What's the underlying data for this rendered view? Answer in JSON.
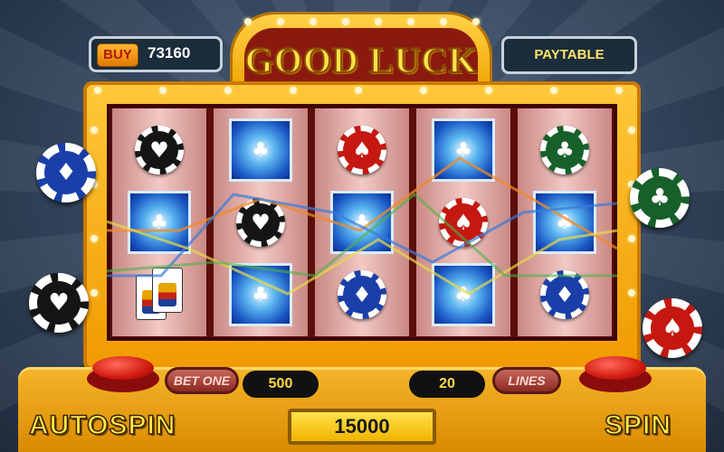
{
  "header": {
    "buy_label": "BUY",
    "credits": "73160",
    "title": "GOOD LUCK",
    "paytable_label": "PAYTABLE"
  },
  "reels": [
    [
      "chip-black-heart",
      "wild",
      "cards-king-queen"
    ],
    [
      "wild",
      "chip-black-heart",
      "wild"
    ],
    [
      "chip-red-spade",
      "wild",
      "chip-blue-diamond"
    ],
    [
      "wild",
      "chip-red-spade",
      "wild"
    ],
    [
      "chip-green-club",
      "wild",
      "chip-blue-diamond"
    ]
  ],
  "side_chips": {
    "left": [
      "chip-blue-diamond",
      "chip-black-heart"
    ],
    "right": [
      "chip-green-club",
      "chip-red-spade"
    ]
  },
  "controls": {
    "autospin_label": "AUTOSPIN",
    "spin_label": "SPIN",
    "bet_one_label": "BET ONE",
    "bet_one_value": "500",
    "lines_label": "LINES",
    "lines_value": "20",
    "total_bet": "15000"
  },
  "colors": {
    "cabinet": "#f0a400",
    "reel_bg": "#f2c9c5",
    "accent_text": "#ffe84a",
    "chip_black": "#151515",
    "chip_red": "#c41810",
    "chip_blue": "#1b3fa8",
    "chip_green": "#17602a"
  }
}
